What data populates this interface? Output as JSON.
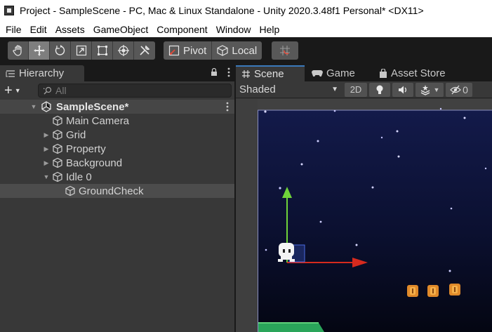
{
  "window": {
    "title": "Project - SampleScene - PC, Mac & Linux Standalone - Unity 2020.3.48f1 Personal* <DX11>"
  },
  "menu": {
    "items": [
      "File",
      "Edit",
      "Assets",
      "GameObject",
      "Component",
      "Window",
      "Help"
    ]
  },
  "toolbar": {
    "tools": [
      {
        "name": "hand-tool",
        "active": false
      },
      {
        "name": "move-tool",
        "active": true
      },
      {
        "name": "rotate-tool",
        "active": false
      },
      {
        "name": "scale-tool",
        "active": false
      },
      {
        "name": "rect-tool",
        "active": false
      },
      {
        "name": "transform-tool",
        "active": false
      },
      {
        "name": "custom-tool",
        "active": false
      }
    ],
    "pivot_label": "Pivot",
    "local_label": "Local"
  },
  "hierarchy": {
    "tab_label": "Hierarchy",
    "search_placeholder": "All",
    "scene_name": "SampleScene*",
    "items": [
      {
        "label": "Main Camera",
        "has_children": false,
        "expanded": false,
        "depth": 1,
        "selected": false
      },
      {
        "label": "Grid",
        "has_children": true,
        "expanded": false,
        "depth": 1,
        "selected": false
      },
      {
        "label": "Property",
        "has_children": true,
        "expanded": false,
        "depth": 1,
        "selected": false
      },
      {
        "label": "Background",
        "has_children": true,
        "expanded": false,
        "depth": 1,
        "selected": false
      },
      {
        "label": "Idle 0",
        "has_children": true,
        "expanded": true,
        "depth": 1,
        "selected": false
      },
      {
        "label": "GroundCheck",
        "has_children": false,
        "expanded": false,
        "depth": 2,
        "selected": true
      }
    ]
  },
  "scene_view": {
    "tabs": [
      {
        "label": "Scene",
        "icon": "grid-icon",
        "active": true
      },
      {
        "label": "Game",
        "icon": "gamepad-icon",
        "active": false
      },
      {
        "label": "Asset Store",
        "icon": "bag-icon",
        "active": false
      }
    ],
    "shading_mode": "Shaded",
    "mode_2d_label": "2D",
    "hidden_count": "0"
  },
  "colors": {
    "sky_top": "#131a4a",
    "sky_bottom": "#040612",
    "gizmo_y": "#6fd33a",
    "gizmo_x": "#d62a1e",
    "ground": "#2aa55a",
    "coin": "#e08a2a",
    "active_tab": "#3a79bb"
  }
}
